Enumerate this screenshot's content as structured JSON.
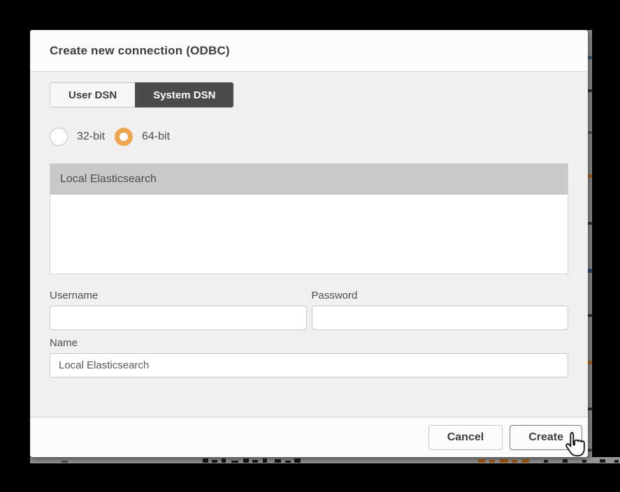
{
  "dialog": {
    "title": "Create new connection (ODBC)",
    "tabs": [
      {
        "label": "User DSN",
        "selected": false
      },
      {
        "label": "System DSN",
        "selected": true
      }
    ],
    "architecture_options": [
      {
        "label": "32-bit",
        "selected": false
      },
      {
        "label": "64-bit",
        "selected": true
      }
    ],
    "dsn_list": [
      {
        "label": "Local Elasticsearch",
        "selected": true
      }
    ],
    "fields": {
      "username": {
        "label": "Username",
        "value": ""
      },
      "password": {
        "label": "Password",
        "value": ""
      },
      "name": {
        "label": "Name",
        "value": "Local Elasticsearch"
      }
    },
    "buttons": {
      "cancel": "Cancel",
      "create": "Create"
    }
  },
  "cursor": {
    "type": "hand-pointer"
  },
  "colors": {
    "accent_orange": "#efa54f",
    "selected_tab_bg": "#4b4b4b",
    "selected_row_bg": "#c9c9c9",
    "overlay": "#000000"
  }
}
